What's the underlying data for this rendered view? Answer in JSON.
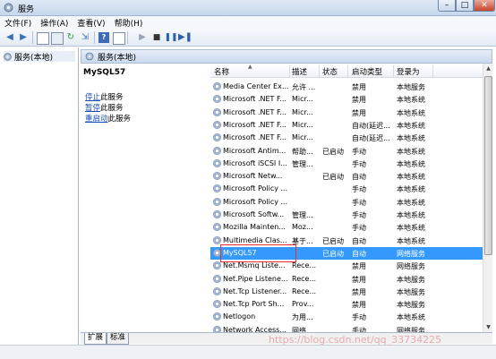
{
  "window": {
    "title": "服务",
    "close_label": "✕",
    "min_label": "–",
    "max_label": "□"
  },
  "menu": [
    "文件(F)",
    "操作(A)",
    "查看(V)",
    "帮助(H)"
  ],
  "toolbar": {
    "buttons": [
      "back-icon",
      "forward-icon",
      "console-tree-icon",
      "properties-icon",
      "refresh-icon",
      "export-icon",
      "help-icon",
      "show-hide-icon",
      "start-icon",
      "stop-icon",
      "pause-icon",
      "restart-icon"
    ]
  },
  "tree": {
    "item_label": "服务(本地)"
  },
  "right_header": {
    "label": "服务(本地)"
  },
  "details": {
    "service_name": "MySQL57",
    "actions": [
      {
        "link": "停止",
        "suffix": "此服务"
      },
      {
        "link": "暂停",
        "suffix": "此服务"
      },
      {
        "link": "重启动",
        "suffix": "此服务"
      }
    ]
  },
  "table": {
    "columns": [
      "名称",
      "描述",
      "状态",
      "启动类型",
      "登录为"
    ],
    "selected_index": 13,
    "rows": [
      [
        "Media Center Ex...",
        "允许 ...",
        "",
        "禁用",
        "本地服务"
      ],
      [
        "Microsoft .NET F...",
        "Micr...",
        "",
        "禁用",
        "本地系统"
      ],
      [
        "Microsoft .NET F...",
        "Micr...",
        "",
        "禁用",
        "本地系统"
      ],
      [
        "Microsoft .NET F...",
        "Micr...",
        "",
        "自动(延迟...",
        "本地系统"
      ],
      [
        "Microsoft .NET F...",
        "Micr...",
        "",
        "自动(延迟...",
        "本地系统"
      ],
      [
        "Microsoft Antim...",
        "帮助...",
        "已启动",
        "手动",
        "本地系统"
      ],
      [
        "Microsoft iSCSI I...",
        "管理...",
        "",
        "手动",
        "本地系统"
      ],
      [
        "Microsoft Netw...",
        "",
        "已启动",
        "自动",
        "本地系统"
      ],
      [
        "Microsoft Policy ...",
        "",
        "",
        "手动",
        "本地系统"
      ],
      [
        "Microsoft Policy ...",
        "",
        "",
        "手动",
        "本地系统"
      ],
      [
        "Microsoft Softw...",
        "管理...",
        "",
        "手动",
        "本地系统"
      ],
      [
        "Mozilla Mainten...",
        "Moz...",
        "",
        "手动",
        "本地系统"
      ],
      [
        "Multimedia Clas...",
        "基于...",
        "已启动",
        "自动",
        "本地系统"
      ],
      [
        "MySQL57",
        "",
        "已启动",
        "自动",
        "网络服务"
      ],
      [
        "Net.Msmq Liste...",
        "Rece...",
        "",
        "禁用",
        "网络服务"
      ],
      [
        "Net.Pipe Listene...",
        "Rece...",
        "",
        "禁用",
        "本地服务"
      ],
      [
        "Net.Tcp Listener...",
        "Rece...",
        "",
        "禁用",
        "本地服务"
      ],
      [
        "Net.Tcp Port Sh...",
        "Prov...",
        "",
        "禁用",
        "本地服务"
      ],
      [
        "Netlogon",
        "为用...",
        "",
        "手动",
        "本地系统"
      ],
      [
        "Network Access...",
        "网络...",
        "",
        "手动",
        "网络服务"
      ]
    ]
  },
  "tabs": [
    "扩展",
    "标准"
  ],
  "watermark": "https://blog.csdn.net/qq_33734225"
}
